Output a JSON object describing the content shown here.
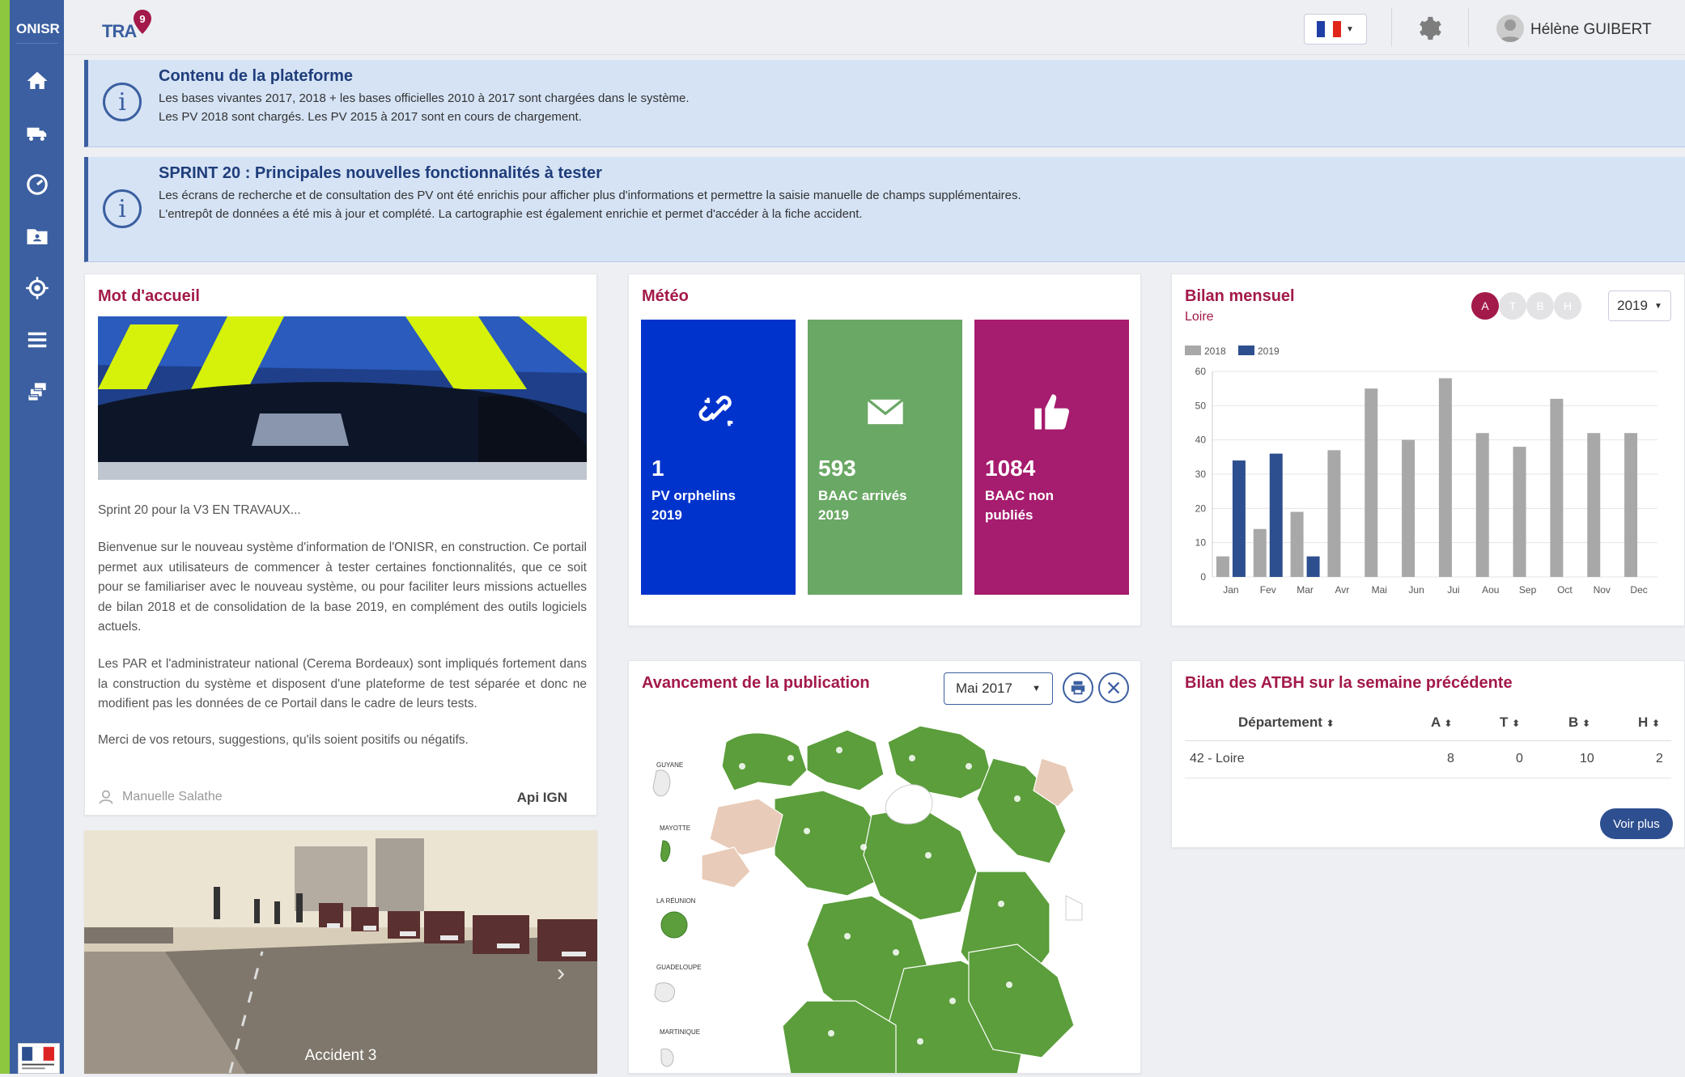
{
  "sidebar": {
    "logo": "ONISR",
    "items": [
      {
        "icon": "home-icon"
      },
      {
        "icon": "truck-icon"
      },
      {
        "icon": "dashboard-icon"
      },
      {
        "icon": "id-card-folder-icon"
      },
      {
        "icon": "crosshair-icon"
      },
      {
        "icon": "menu-icon"
      },
      {
        "icon": "database-icon"
      }
    ]
  },
  "header": {
    "app_logo": "TRA",
    "language_flag": "FR",
    "user_name": "Hélène GUIBERT"
  },
  "banners": [
    {
      "title": "Contenu de la plateforme",
      "lines": [
        "Les bases vivantes 2017, 2018 + les bases officielles 2010 à 2017 sont chargées dans le système.",
        "Les PV 2018 sont chargés. Les PV 2015 à 2017 sont en cours de chargement."
      ]
    },
    {
      "title": "SPRINT 20 : Principales nouvelles fonctionnalités à tester",
      "lines": [
        "Les écrans de recherche et de consultation des PV ont été enrichis pour afficher plus d'informations et permettre la saisie manuelle de champs supplémentaires.",
        "L'entrepôt de données a été mis à jour et complété. La cartographie est également enrichie et permet d'accéder à la fiche accident."
      ]
    }
  ],
  "welcome": {
    "title": "Mot d'accueil",
    "subtitle": "Sprint 20 pour la V3 EN TRAVAUX...",
    "paragraphs": [
      "Bienvenue sur le nouveau système d'information de l'ONISR, en construction. Ce portail permet aux utilisateurs de commencer à tester certaines fonctionnalités, que ce soit pour se familiariser avec le nouveau système, ou pour faciliter leurs missions actuelles de bilan 2018 et de consolidation de la base 2019, en complément des outils logiciels actuels.",
      "Les PAR et l'administrateur national (Cerema Bordeaux) sont impliqués fortement dans la construction du système et disposent d'une plateforme de test séparée et donc ne modifient pas les données de ce Portail dans le cadre de leurs tests.",
      "Merci de vos retours, suggestions, qu'ils soient positifs ou négatifs."
    ],
    "author": "Manuelle Salathe",
    "api": "Api IGN"
  },
  "carousel": {
    "caption": "Accident 3"
  },
  "meteo": {
    "title": "Météo",
    "tiles": [
      {
        "value": "1",
        "label1": "PV orphelins",
        "label2": "2019",
        "color": "#0033cc",
        "icon": "broken-link-icon"
      },
      {
        "value": "593",
        "label1": "BAAC arrivés",
        "label2": "2019",
        "color": "#6aa865",
        "icon": "envelope-icon"
      },
      {
        "value": "1084",
        "label1": "BAAC non",
        "label2": "publiés",
        "color": "#a61c6e",
        "icon": "thumbs-up-icon"
      }
    ]
  },
  "bilan": {
    "title": "Bilan mensuel",
    "region": "Loire",
    "letters": [
      "A",
      "T",
      "B",
      "H"
    ],
    "year": "2019"
  },
  "chart_data": {
    "type": "bar",
    "categories": [
      "Jan",
      "Fev",
      "Mar",
      "Avr",
      "Mai",
      "Jun",
      "Jui",
      "Aou",
      "Sep",
      "Oct",
      "Nov",
      "Dec"
    ],
    "series": [
      {
        "name": "2018",
        "color": "#a8a8a8",
        "values": [
          6,
          14,
          19,
          37,
          55,
          40,
          58,
          42,
          38,
          52,
          42,
          42
        ]
      },
      {
        "name": "2019",
        "color": "#2e4f8f",
        "values": [
          34,
          36,
          6,
          null,
          null,
          null,
          null,
          null,
          null,
          null,
          null,
          null
        ]
      }
    ],
    "ylim": [
      0,
      60
    ],
    "yticks": [
      0,
      10,
      20,
      30,
      40,
      50,
      60
    ],
    "legend": "top-left",
    "grid": true
  },
  "publication": {
    "title": "Avancement de la publication",
    "month": "Mai 2017",
    "overseas": [
      "GUYANE",
      "MAYOTTE",
      "LA RÉUNION",
      "GUADELOUPE",
      "MARTINIQUE"
    ]
  },
  "atbh": {
    "title": "Bilan des ATBH sur la semaine précédente",
    "columns": [
      "Département",
      "A",
      "T",
      "B",
      "H"
    ],
    "rows": [
      [
        "42 - Loire",
        "8",
        "0",
        "10",
        "2"
      ]
    ],
    "button": "Voir plus"
  }
}
